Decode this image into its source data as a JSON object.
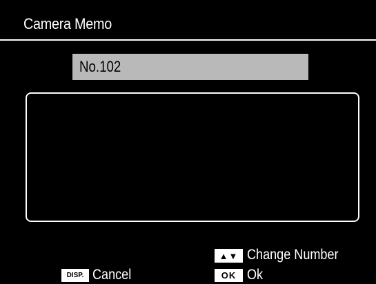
{
  "header": {
    "title": "Camera Memo"
  },
  "memo": {
    "number_text": "No.102",
    "content": ""
  },
  "footer": {
    "change_number": {
      "key_label": "▲▼",
      "label": "Change Number"
    },
    "ok": {
      "key_label": "OK",
      "label": "Ok"
    },
    "cancel": {
      "key_label": "DISP.",
      "label": "Cancel"
    }
  },
  "colors": {
    "background": "#000000",
    "text": "#ffffff",
    "number_field_bg": "#b9b9b9",
    "key_bg": "#ffffff"
  }
}
